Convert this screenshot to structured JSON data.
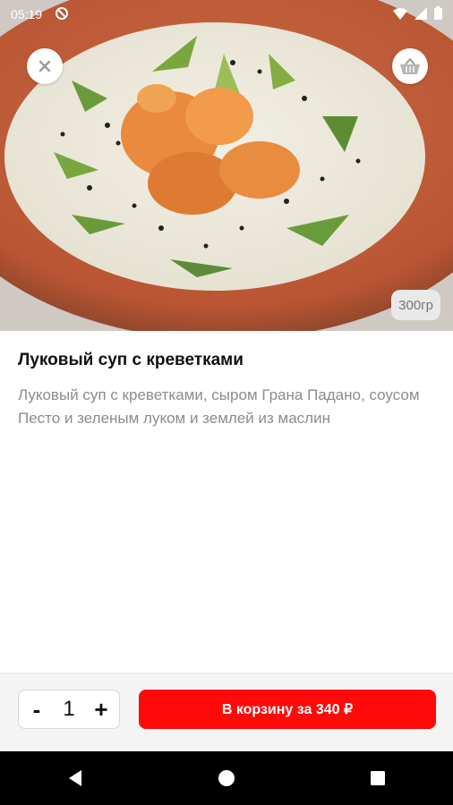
{
  "status_bar": {
    "time": "05:19",
    "icons": [
      "do-not-disturb-icon",
      "wifi-icon",
      "signal-icon",
      "battery-icon"
    ]
  },
  "product": {
    "weight": "300гр",
    "title": "Луковый суп с креветками",
    "description": "Луковый суп с креветками, сыром Грана Падано, соусом Песто и зеленым луком и землей из маслин"
  },
  "cart": {
    "decrement_label": "-",
    "quantity": "1",
    "increment_label": "+",
    "add_button_label": "В корзину за 340 ₽"
  },
  "colors": {
    "accent": "#ff0a0a",
    "bottom_bar_bg": "#f4f4f4",
    "nav_bg": "#000000"
  },
  "nav": {
    "icons": [
      "back-icon",
      "home-icon",
      "recents-icon"
    ]
  }
}
